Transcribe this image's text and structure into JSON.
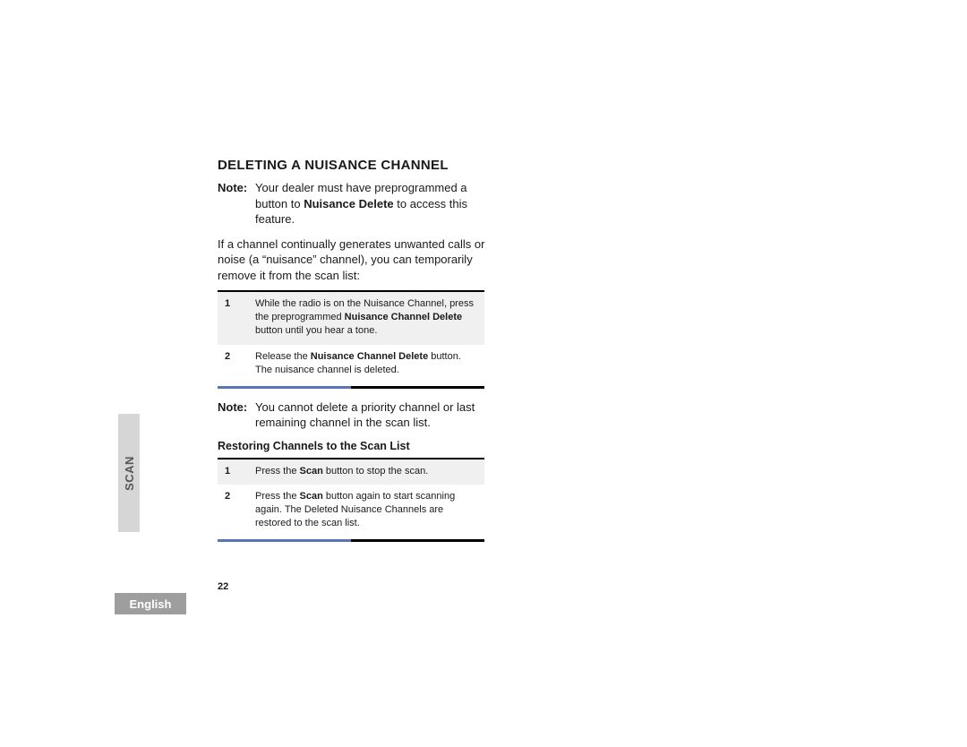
{
  "side_tab": "SCAN",
  "lang_tab": "English",
  "page_number": "22",
  "heading": "DELETING A NUISANCE CHANNEL",
  "note1": {
    "label": "Note:",
    "pre": "Your dealer must have preprogrammed a button to ",
    "bold": "Nuisance Delete",
    "post": " to access this feature."
  },
  "para1": "If a channel continually generates unwanted calls or noise (a “nuisance” channel), you can temporarily remove it from the scan list:",
  "steps1": [
    {
      "n": "1",
      "pre": "While the radio is on the Nuisance Channel, press the preprogrammed ",
      "bold": "Nuisance Channel Delete",
      "post": " button until you hear a tone."
    },
    {
      "n": "2",
      "pre": "Release the ",
      "bold": "Nuisance Channel Delete",
      "post": " button. The nuisance channel is deleted."
    }
  ],
  "note2": {
    "label": "Note:",
    "text": "You cannot delete a priority channel or last remaining channel in the scan list."
  },
  "subheading": "Restoring Channels to the Scan List",
  "steps2": [
    {
      "n": "1",
      "pre": "Press the ",
      "bold": "Scan",
      "post": " button to stop the scan."
    },
    {
      "n": "2",
      "pre": "Press the ",
      "bold": "Scan",
      "post": " button again to start scanning again. The Deleted Nuisance Channels are restored to the scan list."
    }
  ]
}
